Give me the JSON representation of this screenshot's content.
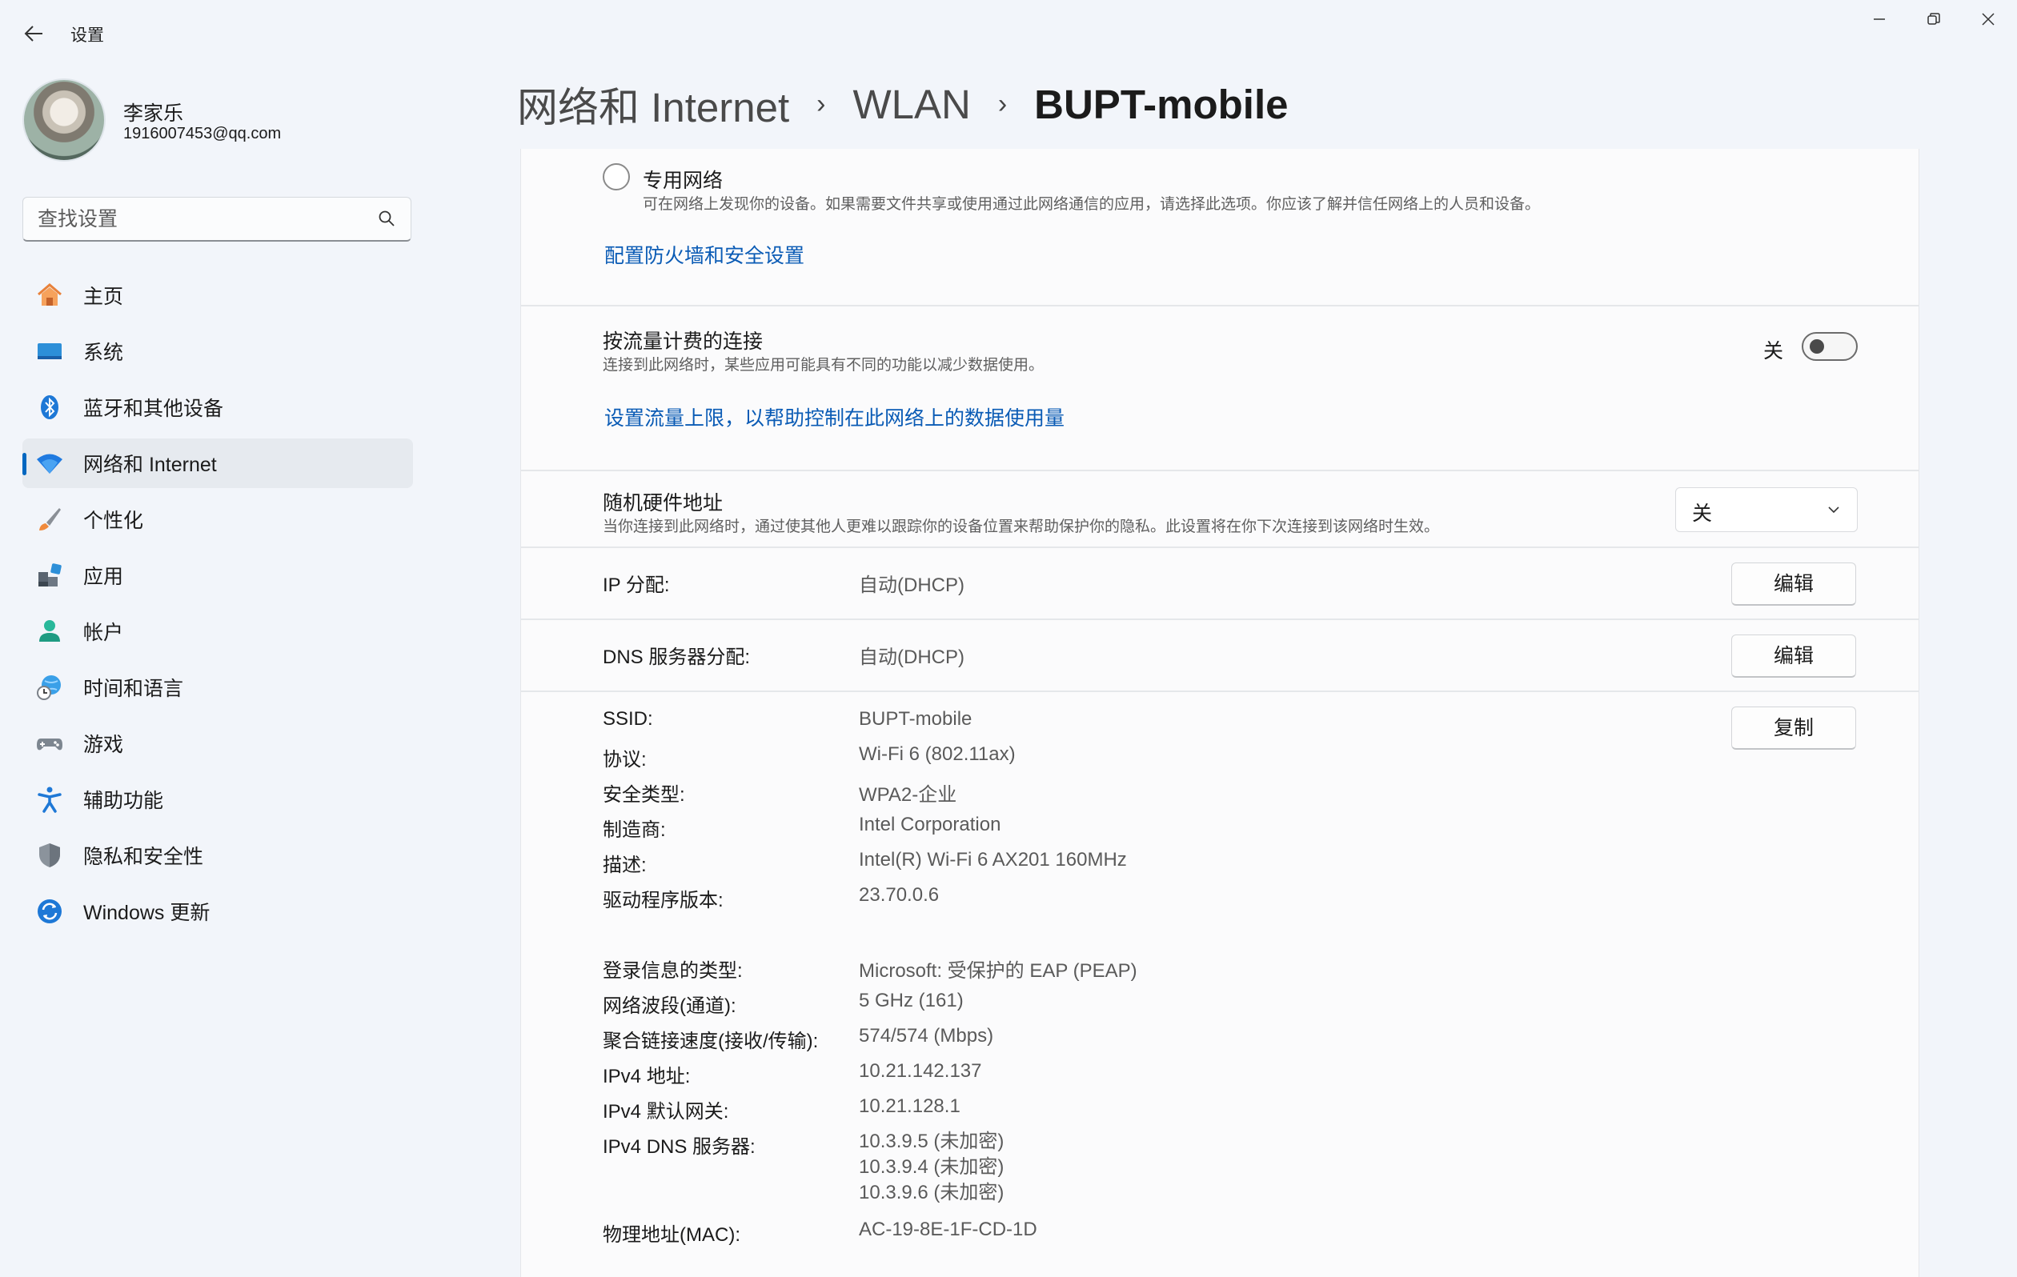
{
  "window": {
    "title": "设置",
    "back_icon": "back-arrow-icon",
    "controls": [
      "minimize-icon",
      "restore-icon",
      "close-icon"
    ]
  },
  "user": {
    "name": "李家乐",
    "email": "1916007453@qq.com"
  },
  "search": {
    "placeholder": "查找设置",
    "icon": "search-icon"
  },
  "nav": {
    "items": [
      {
        "label": "主页",
        "icon": "home-icon"
      },
      {
        "label": "系统",
        "icon": "system-display-icon"
      },
      {
        "label": "蓝牙和其他设备",
        "icon": "bluetooth-icon"
      },
      {
        "label": "网络和 Internet",
        "icon": "wifi-icon",
        "active": true
      },
      {
        "label": "个性化",
        "icon": "paintbrush-icon"
      },
      {
        "label": "应用",
        "icon": "apps-icon"
      },
      {
        "label": "帐户",
        "icon": "account-icon"
      },
      {
        "label": "时间和语言",
        "icon": "globe-clock-icon"
      },
      {
        "label": "游戏",
        "icon": "gamepad-icon"
      },
      {
        "label": "辅助功能",
        "icon": "accessibility-icon"
      },
      {
        "label": "隐私和安全性",
        "icon": "shield-icon"
      },
      {
        "label": "Windows 更新",
        "icon": "windows-update-icon"
      }
    ]
  },
  "breadcrumb": {
    "items": [
      "网络和 Internet",
      "WLAN",
      "BUPT-mobile"
    ]
  },
  "private_network": {
    "title": "专用网络",
    "description": "可在网络上发现你的设备。如果需要文件共享或使用通过此网络通信的应用，请选择此选项。你应该了解并信任网络上的人员和设备。",
    "selected": false
  },
  "firewall_link": "配置防火墙和安全设置",
  "metered": {
    "title": "按流量计费的连接",
    "description": "连接到此网络时，某些应用可能具有不同的功能以减少数据使用。",
    "state_label": "关",
    "enabled": false,
    "link": "设置流量上限，以帮助控制在此网络上的数据使用量"
  },
  "random_mac": {
    "title": "随机硬件地址",
    "description": "当你连接到此网络时，通过使其他人更难以跟踪你的设备位置来帮助保护你的隐私。此设置将在你下次连接到该网络时生效。",
    "selected": "关"
  },
  "ip_assignment": {
    "label": "IP 分配:",
    "value": "自动(DHCP)",
    "button": "编辑"
  },
  "dns_assignment": {
    "label": "DNS 服务器分配:",
    "value": "自动(DHCP)",
    "button": "编辑"
  },
  "properties": {
    "copy_button": "复制",
    "rows": [
      {
        "label": "SSID:",
        "value": "BUPT-mobile"
      },
      {
        "label": "协议:",
        "value": "Wi-Fi 6 (802.11ax)"
      },
      {
        "label": "安全类型:",
        "value": "WPA2-企业"
      },
      {
        "label": "制造商:",
        "value": "Intel Corporation"
      },
      {
        "label": "描述:",
        "value": "Intel(R) Wi-Fi 6 AX201 160MHz"
      },
      {
        "label": "驱动程序版本:",
        "value": "23.70.0.6"
      },
      {
        "label": "登录信息的类型:",
        "value": "Microsoft: 受保护的 EAP (PEAP)"
      },
      {
        "label": "网络波段(通道):",
        "value": "5 GHz (161)"
      },
      {
        "label": "聚合链接速度(接收/传输):",
        "value": "574/574 (Mbps)"
      },
      {
        "label": "IPv4 地址:",
        "value": "10.21.142.137"
      },
      {
        "label": "IPv4 默认网关:",
        "value": "10.21.128.1"
      }
    ],
    "dns_servers": {
      "label": "IPv4 DNS 服务器:",
      "values": [
        "10.3.9.5 (未加密)",
        "10.3.9.4 (未加密)",
        "10.3.9.6 (未加密)"
      ]
    },
    "mac": {
      "label": "物理地址(MAC):",
      "value": "AC-19-8E-1F-CD-1D"
    }
  },
  "colors": {
    "accent": "#0067c0",
    "link": "#0a5bb5",
    "background": "#f2f5fa"
  }
}
